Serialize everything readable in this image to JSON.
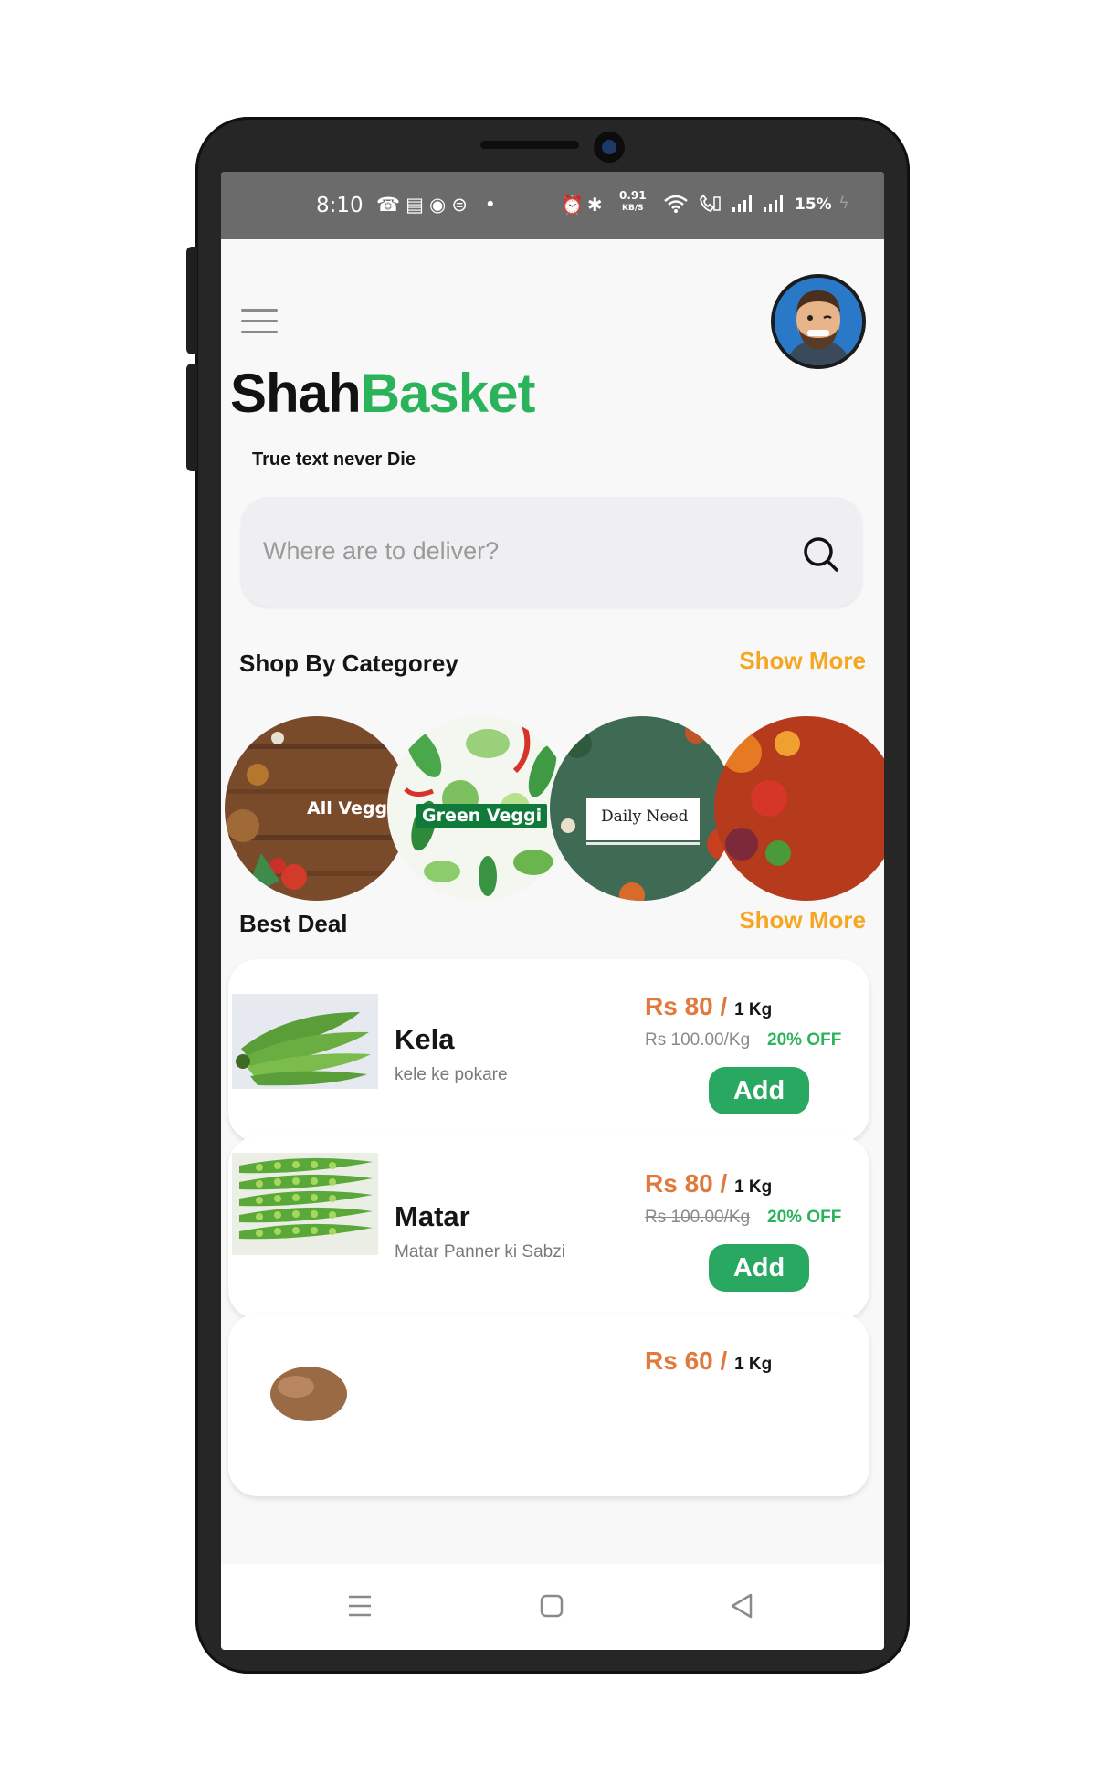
{
  "status_bar": {
    "time": "8:10",
    "net_speed_value": "0.91",
    "net_speed_unit": "KB/S",
    "battery": "15%"
  },
  "header": {
    "brand_part1": "Shah",
    "brand_part2": "Basket",
    "tagline": "True text never Die"
  },
  "search": {
    "placeholder": "Where are to deliver?"
  },
  "categories": {
    "title": "Shop By Categorey",
    "show_more": "Show More",
    "items": [
      {
        "label": "All Veggi"
      },
      {
        "label": "Green Veggi"
      },
      {
        "label": "Daily Need"
      }
    ]
  },
  "best_deal": {
    "title": "Best Deal",
    "show_more": "Show More",
    "products": [
      {
        "name": "Kela",
        "desc": "kele ke pokare",
        "price": "Rs 80 /",
        "unit": "1 Kg",
        "old_price": "Rs 100.00/Kg",
        "discount": "20% OFF",
        "add": "Add"
      },
      {
        "name": "Matar",
        "desc": "Matar Panner ki Sabzi",
        "price": "Rs 80 /",
        "unit": "1 Kg",
        "old_price": "Rs 100.00/Kg",
        "discount": "20% OFF",
        "add": "Add"
      },
      {
        "price": "Rs 60 /",
        "unit": "1 Kg"
      }
    ]
  },
  "colors": {
    "brand_green": "#2bb35b",
    "accent_orange": "#f5a623",
    "price_orange": "#e07a3c",
    "button_green": "#28a861"
  },
  "icons": [
    "menu-icon",
    "search-icon",
    "nav-recents-icon",
    "nav-home-icon",
    "nav-back-icon"
  ]
}
